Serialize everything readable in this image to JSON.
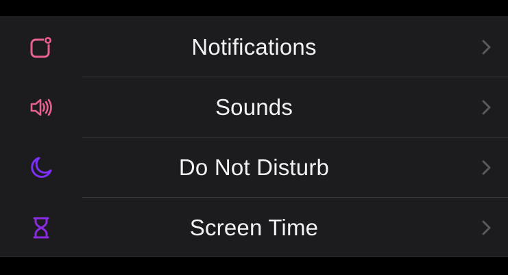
{
  "settings_list": {
    "items": [
      {
        "label": "Notifications",
        "icon": "notifications-badge-icon",
        "icon_color": "#e95f8f"
      },
      {
        "label": "Sounds",
        "icon": "speaker-wave-icon",
        "icon_color": "#e95f8f"
      },
      {
        "label": "Do Not Disturb",
        "icon": "moon-icon",
        "icon_color": "#7b2ff7"
      },
      {
        "label": "Screen Time",
        "icon": "hourglass-icon",
        "icon_color": "#8a2be2"
      }
    ]
  },
  "colors": {
    "background": "#000000",
    "cell_background": "#1c1c1e",
    "separator": "#38383a",
    "label_text": "#f2f2f7",
    "chevron": "#5a5a5e"
  }
}
